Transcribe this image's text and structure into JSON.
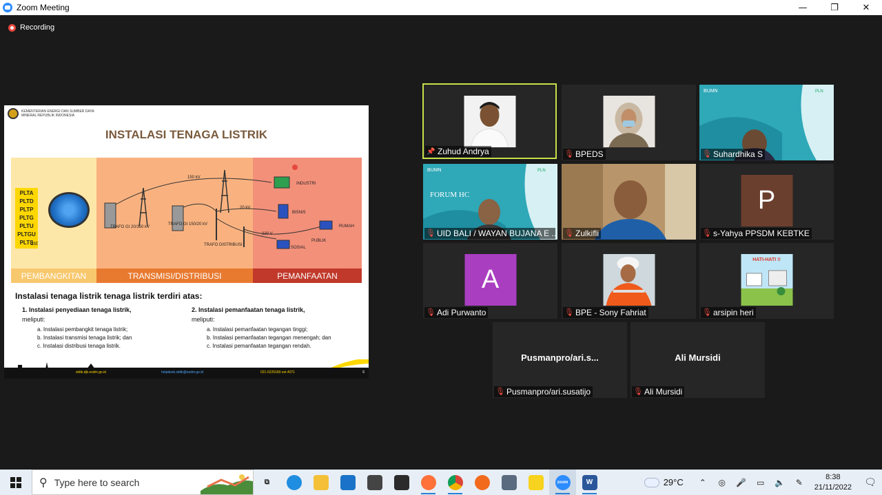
{
  "window": {
    "title": "Zoom Meeting",
    "minimize": "—",
    "restore": "❐",
    "close": "✕"
  },
  "meeting": {
    "recording_label": "Recording"
  },
  "slide": {
    "ministry": "KEMENTERIAN ENERGI DAN SUMBER DAYA MINERAL REPUBLIK INDONESIA",
    "title": "INSTALASI TENAGA LISTRIK",
    "plants": [
      "PLTA",
      "PLTD",
      "PLTP",
      "PLTG",
      "PLTU",
      "PLTGU",
      "PLTS"
    ],
    "plants_more": "dst",
    "labels": {
      "kv150": "150 kV",
      "kv20": "20 kV",
      "v220": "220 V",
      "trafo1": "TRAFO GI 20/150 kV",
      "trafo2": "TRAFO GI 150/20 kV",
      "trafo3": "TRAFO DISTRIBUSI",
      "industri": "INDUSTRI",
      "bisnis": "BISNIS",
      "rumah": "RUMAH",
      "publik": "PUBLIK",
      "sosial": "SOSIAL"
    },
    "zones": [
      "PEMBANGKITAN",
      "TRANSMISI/DISTRIBUSI",
      "PEMANFAATAN"
    ],
    "heading": "Instalasi tenaga listrik tenaga listrik terdiri atas:",
    "col1": {
      "heading": "1.  Instalasi penyediaan tenaga listrik,",
      "sub": "meliputi:",
      "items": [
        "a.   Instalasi pembangkit tenaga listrik;",
        "b.   Instalasi transmisi tenaga listrik; dan",
        "c.   Instalasi distribusi tenaga listrik."
      ]
    },
    "col2": {
      "heading": "2.   Instalasi pemanfaatan tenaga listrik,",
      "sub": "meliputi:",
      "items": [
        "a.   Instalasi pemanfaatan tegangan tinggi;",
        "b.   Instalasi pemanfaatan tegangan menengah; dan",
        "c.   Instalasi pemanfaatan tegangan rendah."
      ]
    },
    "footer": {
      "site": "skttk.djk.esdm.go.id",
      "email": "helpdesk.skttk@esdm.go.id",
      "phone": "021-5225180 ext.4071",
      "page": "6"
    }
  },
  "participants": [
    {
      "name": "Zuhud Andrya",
      "kind": "photo",
      "active": true,
      "pinned": true
    },
    {
      "name": "BPEDS",
      "kind": "photo",
      "active": false
    },
    {
      "name": "Suhardhika S",
      "kind": "video",
      "active": false
    },
    {
      "name": "UID BALI / WAYAN BUJANA E ...",
      "kind": "video",
      "active": false,
      "banner": "FORUM HC"
    },
    {
      "name": "Zulkifli",
      "kind": "video",
      "active": false
    },
    {
      "name": "s-Yahya PPSDM KEBTKE",
      "kind": "letter",
      "letter": "P",
      "color": "#6b3f2e"
    },
    {
      "name": "Adi Purwanto",
      "kind": "letter",
      "letter": "A",
      "color": "#a93ec0"
    },
    {
      "name": "BPE - Sony Fahriat",
      "kind": "photo"
    },
    {
      "name": "arsipin heri",
      "kind": "photo",
      "poster": "HATI-HATI !!"
    },
    {
      "name": "Pusmanpro/ari.susatijo",
      "display": "Pusmanpro/ari.s...",
      "kind": "name"
    },
    {
      "name": "Ali Mursidi",
      "display": "Ali Mursidi",
      "kind": "name"
    }
  ],
  "taskbar": {
    "search_placeholder": "Type here to search",
    "weather": "29°C",
    "time": "8:38",
    "date": "21/11/2022",
    "apps": [
      "task-view",
      "edge",
      "file-explorer",
      "mail",
      "store",
      "app-dark",
      "firefox",
      "chrome",
      "app-orange",
      "app-printer",
      "sticky-notes",
      "zoom",
      "word"
    ]
  },
  "colors": {
    "active_speaker": "#c8e04a",
    "mic_off": "#e5483d",
    "zoom_blue": "#2d8cff"
  }
}
